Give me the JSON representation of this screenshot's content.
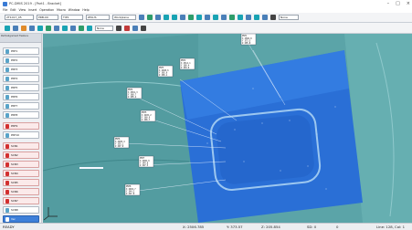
{
  "window": {
    "title": "PC-DMIS 2019 - [Part1 - Bracket]",
    "controls": [
      "–",
      "□",
      "×"
    ]
  },
  "menu": [
    "File",
    "Edit",
    "View",
    "Insert",
    "Operation",
    "Macro",
    "Window",
    "Help"
  ],
  "toolbar1": {
    "boxes": [
      "2T1017_05",
      "PRB-00",
      "TIP1",
      "ZPLUS",
      "Workplane"
    ],
    "view_dropdown": "None"
  },
  "toolbar2": {
    "dropdown": "None"
  },
  "sidebar": {
    "header": "Part/Alignment Feature",
    "items": [
      {
        "label": "PNT1"
      },
      {
        "label": "PNT2"
      },
      {
        "label": "PNT3"
      },
      {
        "label": "PNT4"
      },
      {
        "label": "PNT5"
      },
      {
        "label": "PNT6"
      },
      {
        "label": "PNT7"
      },
      {
        "label": "PNT8"
      },
      {
        "label": "PNT9"
      },
      {
        "label": "PNT10"
      },
      {
        "label": "SCN1"
      },
      {
        "label": "SCN2"
      },
      {
        "label": "SCN3"
      },
      {
        "label": "SCN4"
      },
      {
        "label": "SCN5"
      },
      {
        "label": "SCN6"
      },
      {
        "label": "SCN7"
      },
      {
        "label": "SCN8"
      },
      {
        "label": "Vec"
      }
    ]
  },
  "callouts": [
    {
      "id": "PNT1",
      "rows": [
        "X 2506.8",
        "Y 373.5",
        "Z 205.8"
      ]
    },
    {
      "id": "PNT2",
      "rows": [
        "X 2512.1",
        "Y 380.4",
        "Z 204.9"
      ]
    },
    {
      "id": "PNT3",
      "rows": [
        "X 2498.6",
        "Y 365.0",
        "Z 206.1"
      ]
    },
    {
      "id": "PNT4",
      "rows": [
        "X 2501.3",
        "Y 368.7",
        "Z 205.4"
      ]
    },
    {
      "id": "PNT5",
      "rows": [
        "X 2495.2",
        "Y 360.9",
        "Z 206.7"
      ]
    },
    {
      "id": "PNT6",
      "rows": [
        "X 2490.4",
        "Y 355.1",
        "Z 207.0"
      ]
    },
    {
      "id": "PNT7",
      "rows": [
        "X 2486.9",
        "Y 349.8",
        "Z 207.3"
      ]
    },
    {
      "id": "PNT8",
      "rows": [
        "X 2482.7",
        "Y 344.2",
        "Z 207.8"
      ]
    }
  ],
  "status": {
    "mode": "READY",
    "x": "X: 2506.785",
    "y": "Y: 373.57",
    "z": "Z: 205.854",
    "sd": "SD: 0",
    "zero": "0",
    "line": "Line: 128, Col: 1"
  }
}
